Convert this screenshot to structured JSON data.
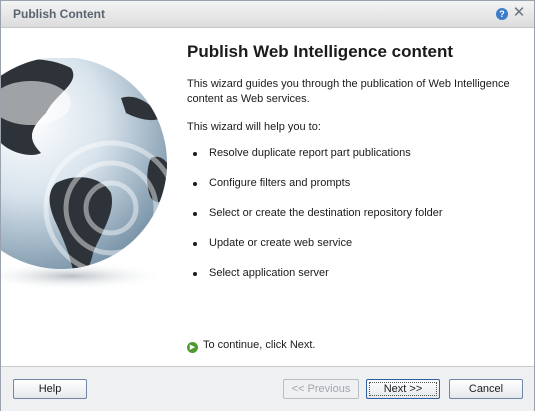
{
  "window": {
    "title": "Publish Content"
  },
  "titlebar": {
    "help_icon": "question-icon",
    "close_icon": "close-icon",
    "help_glyph": "?",
    "close_glyph": "✕"
  },
  "main": {
    "heading": "Publish Web Intelligence content",
    "intro": "This wizard guides you through the publication of Web Intelligence content as Web services.",
    "subintro": "This wizard will help you to:",
    "steps": [
      "Resolve duplicate report part publications",
      "Configure filters and prompts",
      "Select or create the destination repository folder",
      "Update or create web service",
      "Select application server"
    ],
    "continue_text": "To continue, click Next.",
    "continue_icon": "green-arrow-icon",
    "illustration": "globe-illustration"
  },
  "footer": {
    "help_label": "Help",
    "previous_label": "<< Previous",
    "next_label": "Next >>",
    "cancel_label": "Cancel"
  },
  "colors": {
    "accent": "#3d7cc9",
    "continue_icon": "#4d9b2e"
  }
}
